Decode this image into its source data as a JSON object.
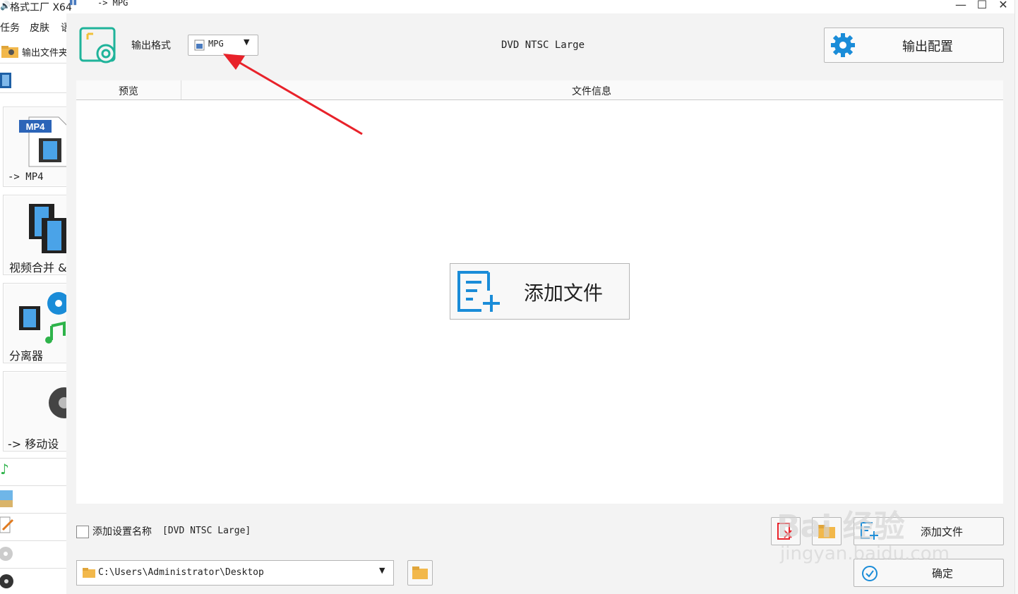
{
  "titlebar": {
    "app_title": "格式工厂 X64",
    "subtitle": "-> MPG",
    "minimize": "—",
    "maximize": "☐",
    "close": "✕"
  },
  "menu": {
    "task": "任务",
    "skin": "皮肤",
    "lang": "语"
  },
  "left_panel": {
    "output_folder_label": "输出文件夹",
    "tools": [
      {
        "label": "-> MP4",
        "badge": "MP4"
      },
      {
        "label": "视频合并 &"
      },
      {
        "label": "分离器"
      },
      {
        "label": "-> 移动设"
      }
    ]
  },
  "dialog": {
    "output_format_label": "输出格式",
    "format_value": "MPG",
    "preset_label": "DVD NTSC Large",
    "output_config_label": "输出配置",
    "table": {
      "col_preview": "预览",
      "col_info": "文件信息"
    },
    "add_file_big_label": "添加文件",
    "add_setting_label": "添加设置名称",
    "add_setting_value": "[DVD NTSC Large]",
    "path": "C:\\Users\\Administrator\\Desktop",
    "add_file_label": "添加文件",
    "ok_label": "确定"
  },
  "watermark": {
    "line1": "Bai 经验",
    "line2": "jingyan.baidu.com"
  },
  "colors": {
    "accent_teal": "#1fb39a",
    "accent_blue": "#1a8cd8",
    "arrow_red": "#e8222a"
  }
}
